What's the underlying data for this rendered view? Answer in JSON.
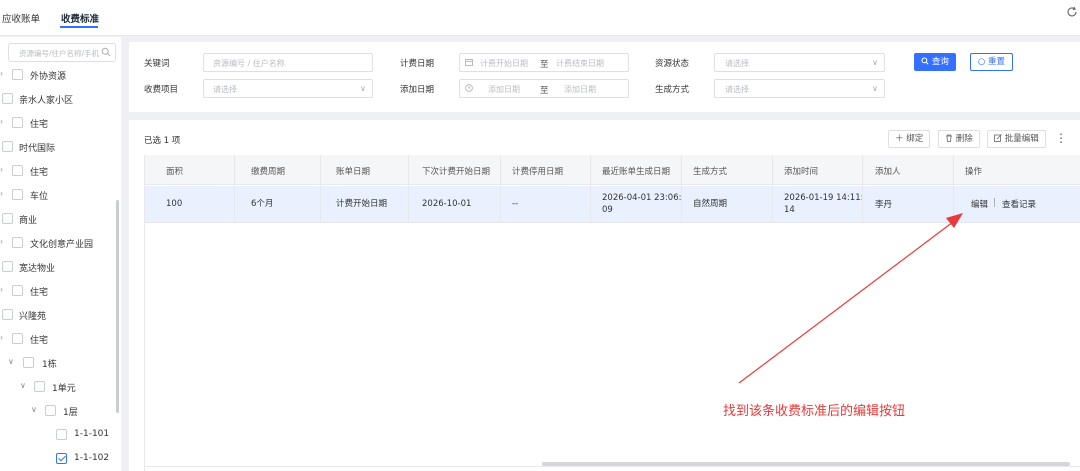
{
  "tabs": [
    {
      "label": "应收账单"
    },
    {
      "label": "收费标准"
    }
  ],
  "sidebar": {
    "search_placeholder": "资源编号/住户名称/手机",
    "items": [
      {
        "label": "外协资源",
        "arrow": "›",
        "checked": false
      },
      {
        "label": "亲水人家小区",
        "arrow": "",
        "checked": false
      },
      {
        "label": "住宅",
        "arrow": "›",
        "checked": false
      },
      {
        "label": "时代国际",
        "arrow": "",
        "checked": false
      },
      {
        "label": "住宅",
        "arrow": "›",
        "checked": false
      },
      {
        "label": "车位",
        "arrow": "›",
        "checked": false
      },
      {
        "label": "商业",
        "arrow": "",
        "checked": false
      },
      {
        "label": "文化创意产业园",
        "arrow": "›",
        "checked": false
      },
      {
        "label": "宽达物业",
        "arrow": "",
        "checked": false
      },
      {
        "label": "住宅",
        "arrow": "›",
        "checked": false
      },
      {
        "label": "兴隆苑",
        "arrow": "",
        "checked": false
      },
      {
        "label": "住宅",
        "arrow": "›",
        "checked": false
      },
      {
        "label": "1栋",
        "arrow": "∨",
        "checked": false
      },
      {
        "label": "1单元",
        "arrow": "∨",
        "checked": false
      },
      {
        "label": "1层",
        "arrow": "∨",
        "checked": false
      },
      {
        "label": "1-1-101",
        "arrow": "",
        "checked": false
      },
      {
        "label": "1-1-102",
        "arrow": "",
        "checked": true
      }
    ]
  },
  "filters": {
    "keyword_label": "关键词",
    "keyword_placeholder": "资源编号 / 住户名称",
    "billing_date_label": "计费日期",
    "billing_start_placeholder": "计费开始日期",
    "billing_end_placeholder": "计费结束日期",
    "range_sep": "至",
    "resource_status_label": "资源状态",
    "select_placeholder": "请选择",
    "fee_item_label": "收费项目",
    "add_date_label": "添加日期",
    "add_start_placeholder": "添加日期",
    "add_end_placeholder": "添加日期",
    "gen_method_label": "生成方式",
    "query_label": "查询",
    "reset_label": "重置"
  },
  "toolbar": {
    "selected_text": "已选 1 项",
    "bind_label": "绑定",
    "delete_label": "删除",
    "batch_edit_label": "批量编辑"
  },
  "table": {
    "headers": [
      "面积",
      "缴费周期",
      "账单日期",
      "下次计费开始日期",
      "计费停用日期",
      "最近账单生成日期",
      "生成方式",
      "添加时间",
      "添加人",
      "操作"
    ],
    "row": {
      "area": "100",
      "cycle": "6个月",
      "bill_date": "计费开始日期",
      "next_start": "2026-10-01",
      "stop_date": "--",
      "last_gen_line1": "2026-04-01 23:06:",
      "last_gen_line2": "09",
      "gen_method": "自然周期",
      "add_time_line1": "2026-01-19 14:11:",
      "add_time_line2": "14",
      "adder": "李丹",
      "edit": "编辑",
      "sep": "|",
      "view_log": "查看记录"
    }
  },
  "annotation": "找到该条收费标准后的编辑按钮",
  "colors": {
    "accent": "#3470ff",
    "annotation": "#e83a3a",
    "selected_row": "#e9f1ff"
  }
}
